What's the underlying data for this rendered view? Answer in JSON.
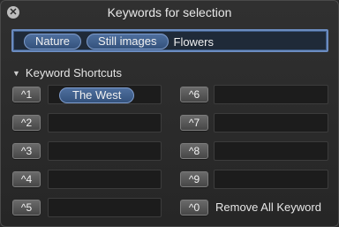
{
  "window": {
    "title": "Keywords for selection"
  },
  "keyword_field": {
    "tokens": [
      "Nature",
      "Still images"
    ],
    "typed_text": "Flowers"
  },
  "shortcuts_section": {
    "label": "Keyword Shortcuts"
  },
  "shortcuts": [
    {
      "key": "^1",
      "keyword": "The West"
    },
    {
      "key": "^2",
      "keyword": ""
    },
    {
      "key": "^3",
      "keyword": ""
    },
    {
      "key": "^4",
      "keyword": ""
    },
    {
      "key": "^5",
      "keyword": ""
    },
    {
      "key": "^6",
      "keyword": ""
    },
    {
      "key": "^7",
      "keyword": ""
    },
    {
      "key": "^8",
      "keyword": ""
    },
    {
      "key": "^9",
      "keyword": ""
    },
    {
      "key": "^0",
      "action": "Remove All Keyword"
    }
  ],
  "icons": {
    "close": "close-icon",
    "disclosure": "disclosure-triangle-icon"
  }
}
